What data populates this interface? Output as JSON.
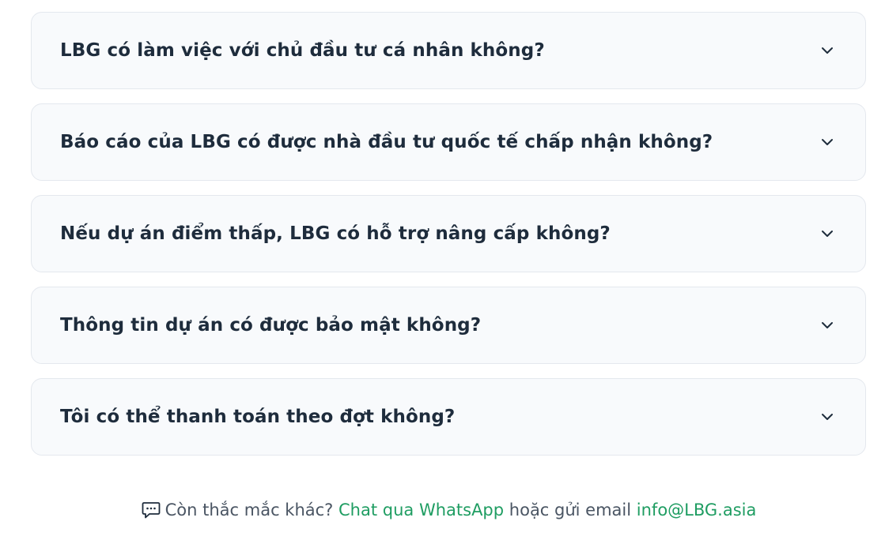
{
  "faq": {
    "items": [
      {
        "question": "LBG có làm việc với chủ đầu tư cá nhân không?"
      },
      {
        "question": "Báo cáo của LBG có được nhà đầu tư quốc tế chấp nhận không?"
      },
      {
        "question": "Nếu dự án điểm thấp, LBG có hỗ trợ nâng cấp không?"
      },
      {
        "question": "Thông tin dự án có được bảo mật không?"
      },
      {
        "question": "Tôi có thể thanh toán theo đợt không?"
      }
    ],
    "icon": "chevron-down-icon"
  },
  "footer": {
    "icon": "chat-bubble-icon",
    "prefix": "Còn thắc mắc khác?",
    "whatsapp_link": "Chat qua WhatsApp",
    "middle": "hoặc gửi email",
    "email_link": "info@LBG.asia",
    "link_color": "#1f9d62"
  }
}
